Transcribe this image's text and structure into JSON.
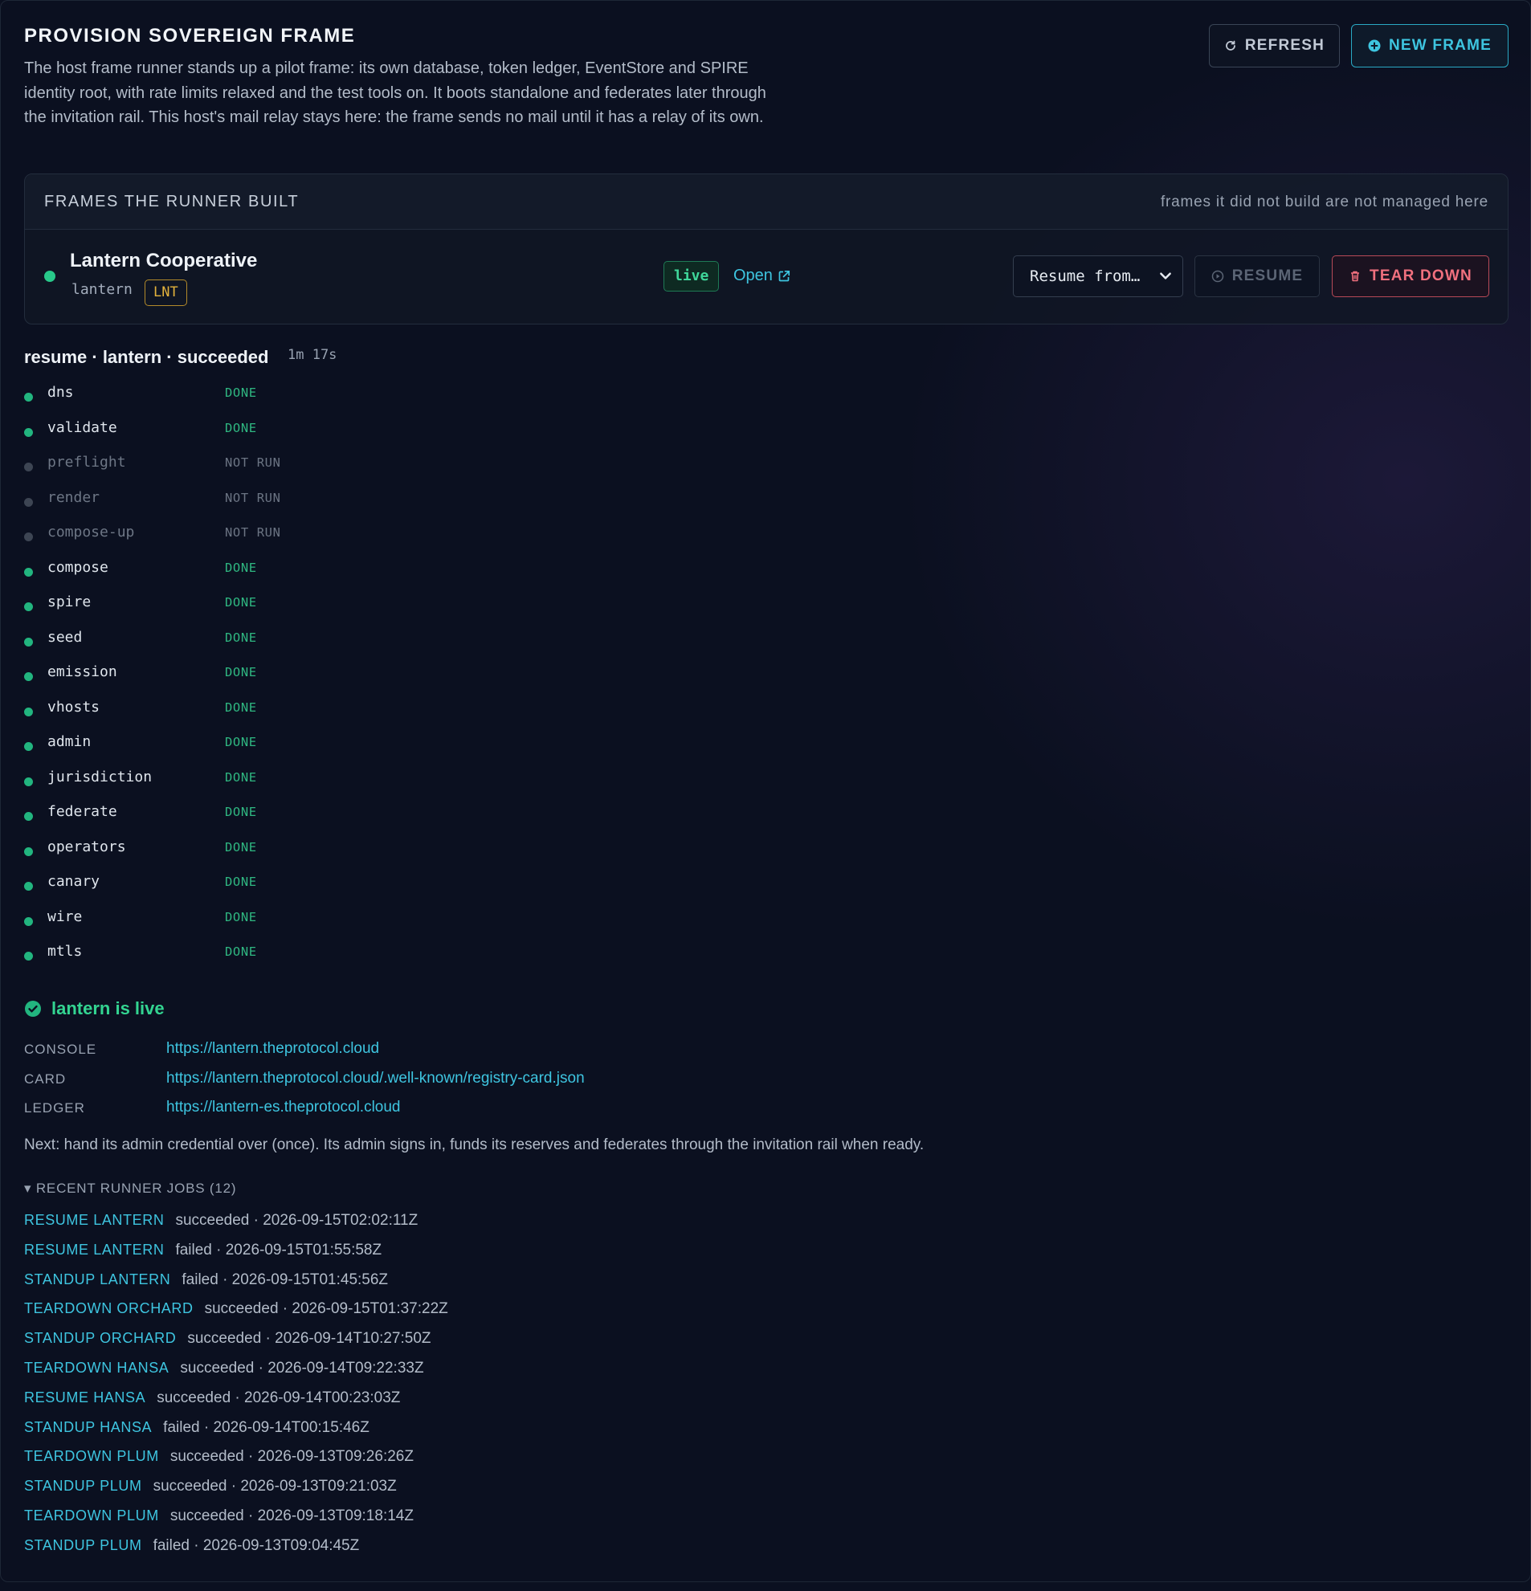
{
  "header": {
    "title": "PROVISION SOVEREIGN FRAME",
    "description": "The host frame runner stands up a pilot frame: its own database, token ledger, EventStore and SPIRE identity root, with rate limits relaxed and the test tools on. It boots standalone and federates later through the invitation rail. This host's mail relay stays here: the frame sends no mail until it has a relay of its own.",
    "refresh_label": "REFRESH",
    "new_frame_label": "NEW FRAME"
  },
  "frames_panel": {
    "title": "FRAMES THE RUNNER BUILT",
    "note": "frames it did not build are not managed here",
    "frame": {
      "name": "Lantern Cooperative",
      "slug": "lantern",
      "ticker": "LNT",
      "status_badge": "live",
      "open_label": "Open",
      "resume_select_value": "Resume from…",
      "resume_label": "RESUME",
      "teardown_label": "TEAR DOWN"
    }
  },
  "run": {
    "title": "resume · lantern · succeeded",
    "duration": "1m 17s",
    "steps": [
      {
        "name": "dns",
        "status": "DONE"
      },
      {
        "name": "validate",
        "status": "DONE"
      },
      {
        "name": "preflight",
        "status": "NOT RUN"
      },
      {
        "name": "render",
        "status": "NOT RUN"
      },
      {
        "name": "compose-up",
        "status": "NOT RUN"
      },
      {
        "name": "compose",
        "status": "DONE"
      },
      {
        "name": "spire",
        "status": "DONE"
      },
      {
        "name": "seed",
        "status": "DONE"
      },
      {
        "name": "emission",
        "status": "DONE"
      },
      {
        "name": "vhosts",
        "status": "DONE"
      },
      {
        "name": "admin",
        "status": "DONE"
      },
      {
        "name": "jurisdiction",
        "status": "DONE"
      },
      {
        "name": "federate",
        "status": "DONE"
      },
      {
        "name": "operators",
        "status": "DONE"
      },
      {
        "name": "canary",
        "status": "DONE"
      },
      {
        "name": "wire",
        "status": "DONE"
      },
      {
        "name": "mtls",
        "status": "DONE"
      }
    ]
  },
  "result": {
    "headline": "lantern is live",
    "endpoints": [
      {
        "label": "CONSOLE",
        "url": "https://lantern.theprotocol.cloud"
      },
      {
        "label": "CARD",
        "url": "https://lantern.theprotocol.cloud/.well-known/registry-card.json"
      },
      {
        "label": "LEDGER",
        "url": "https://lantern-es.theprotocol.cloud"
      }
    ],
    "next_note": "Next: hand its admin credential over (once). Its admin signs in, funds its reserves and federates through the invitation rail when ready."
  },
  "jobs": {
    "toggle_label": "▾ RECENT RUNNER JOBS (12)",
    "items": [
      {
        "name": "RESUME LANTERN",
        "meta": "succeeded · 2026-09-15T02:02:11Z"
      },
      {
        "name": "RESUME LANTERN",
        "meta": "failed · 2026-09-15T01:55:58Z"
      },
      {
        "name": "STANDUP LANTERN",
        "meta": "failed · 2026-09-15T01:45:56Z"
      },
      {
        "name": "TEARDOWN ORCHARD",
        "meta": "succeeded · 2026-09-15T01:37:22Z"
      },
      {
        "name": "STANDUP ORCHARD",
        "meta": "succeeded · 2026-09-14T10:27:50Z"
      },
      {
        "name": "TEARDOWN HANSA",
        "meta": "succeeded · 2026-09-14T09:22:33Z"
      },
      {
        "name": "RESUME HANSA",
        "meta": "succeeded · 2026-09-14T00:23:03Z"
      },
      {
        "name": "STANDUP HANSA",
        "meta": "failed · 2026-09-14T00:15:46Z"
      },
      {
        "name": "TEARDOWN PLUM",
        "meta": "succeeded · 2026-09-13T09:26:26Z"
      },
      {
        "name": "STANDUP PLUM",
        "meta": "succeeded · 2026-09-13T09:21:03Z"
      },
      {
        "name": "TEARDOWN PLUM",
        "meta": "succeeded · 2026-09-13T09:18:14Z"
      },
      {
        "name": "STANDUP PLUM",
        "meta": "failed · 2026-09-13T09:04:45Z"
      }
    ]
  },
  "colors": {
    "background": "#0b1020",
    "accent": "#3ec5e0",
    "success": "#2fb781",
    "danger": "#f0707e",
    "ticker": "#e3b23c"
  }
}
